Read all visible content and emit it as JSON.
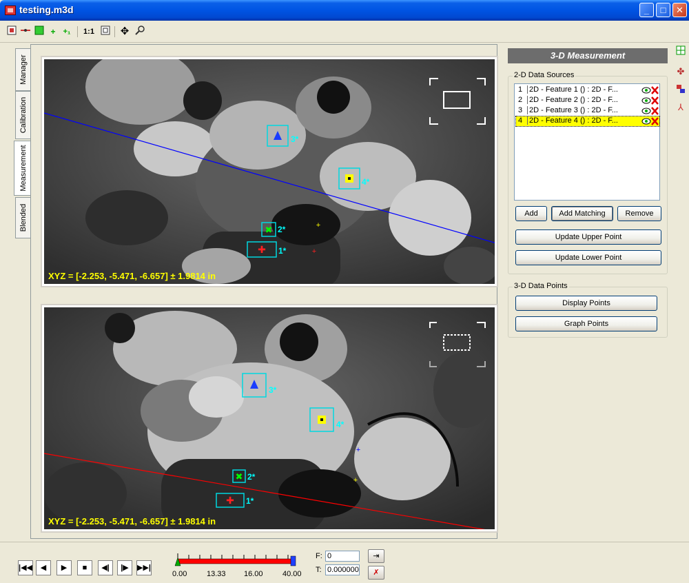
{
  "window": {
    "title": "testing.m3d"
  },
  "tabs": [
    "Manager",
    "Calibration",
    "Measurement",
    "Blended"
  ],
  "views": {
    "upper": {
      "xyz": "XYZ = [-2.253, -5.471, -6.657]  ± 1.9814 in",
      "features": [
        "1*",
        "2*",
        "3*",
        "4*"
      ]
    },
    "lower": {
      "xyz": "XYZ = [-2.253, -5.471, -6.657]  ± 1.9814 in",
      "features": [
        "1*",
        "2*",
        "3*",
        "4*"
      ]
    }
  },
  "panel": {
    "title": "3-D Measurement",
    "sources_group": "2-D Data Sources",
    "sources": [
      {
        "index": "1",
        "name": "2D - Feature 1 () : 2D - F..."
      },
      {
        "index": "2",
        "name": "2D - Feature 2 () : 2D - F..."
      },
      {
        "index": "3",
        "name": "2D - Feature 3 () : 2D - F..."
      },
      {
        "index": "4",
        "name": "2D - Feature 4 () : 2D - F..."
      }
    ],
    "selected_source": 4,
    "add_label": "Add",
    "add_matching_label": "Add Matching",
    "remove_label": "Remove",
    "update_upper_label": "Update Upper Point",
    "update_lower_label": "Update Lower Point",
    "points_group": "3-D Data Points",
    "display_points_label": "Display Points",
    "graph_points_label": "Graph Points"
  },
  "timeline": {
    "ticks": [
      "0.00",
      "13.33",
      "16.00",
      "40.00"
    ],
    "frame_label": "F:",
    "frame_value": "0",
    "time_label": "T:",
    "time_value": "0.000000"
  },
  "toolbar": {
    "zoom_label": "1:1"
  },
  "colors": {
    "accent_line_upper": "#0000ff",
    "accent_line_lower": "#ff0000",
    "feature_box": "#00d8e0",
    "readout": "#ffff00",
    "selected_row": "#ffff00"
  }
}
